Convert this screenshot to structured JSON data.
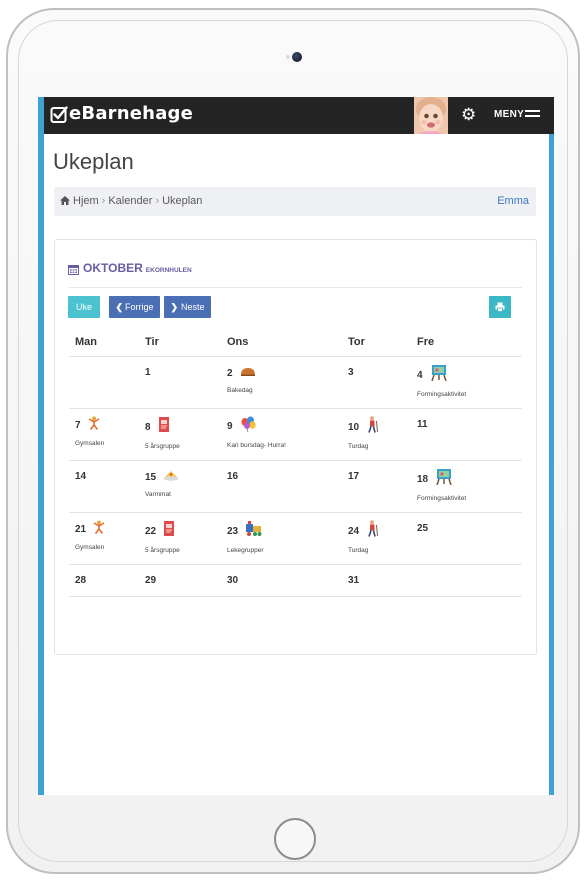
{
  "app": {
    "logo_text": "eBarnehage",
    "menu_label": "MENY"
  },
  "page": {
    "title": "Ukeplan"
  },
  "breadcrumb": {
    "items": [
      "Hjem",
      "Kalender",
      "Ukeplan"
    ],
    "user": "Emma"
  },
  "calendar": {
    "month": "OKTOBER",
    "group": "EKORNHULEN",
    "buttons": {
      "week": "Uke",
      "prev": "Forrige",
      "next": "Neste"
    },
    "days": [
      "Man",
      "Tir",
      "Ons",
      "Tor",
      "Fre"
    ],
    "weeks": [
      [
        {
          "day": "",
          "event": "",
          "icon": ""
        },
        {
          "day": "1",
          "event": "",
          "icon": ""
        },
        {
          "day": "2",
          "event": "Bakedag",
          "icon": "bread-icon"
        },
        {
          "day": "3",
          "event": "",
          "icon": ""
        },
        {
          "day": "4",
          "event": "Formingsaktivitet",
          "icon": "easel-icon"
        }
      ],
      [
        {
          "day": "7",
          "event": "Gymsalen",
          "icon": "gymnast-icon"
        },
        {
          "day": "8",
          "event": "5 årsgruppe",
          "icon": "book-icon"
        },
        {
          "day": "9",
          "event": "Kari bursdag- Hurra!",
          "icon": "balloons-icon"
        },
        {
          "day": "10",
          "event": "Turdag",
          "icon": "hiker-icon"
        },
        {
          "day": "11",
          "event": "",
          "icon": ""
        }
      ],
      [
        {
          "day": "14",
          "event": "",
          "icon": ""
        },
        {
          "day": "15",
          "event": "Varmmat",
          "icon": "food-icon"
        },
        {
          "day": "16",
          "event": "",
          "icon": ""
        },
        {
          "day": "17",
          "event": "",
          "icon": ""
        },
        {
          "day": "18",
          "event": "Formingsaktivitet",
          "icon": "easel-icon"
        }
      ],
      [
        {
          "day": "21",
          "event": "Gymsalen",
          "icon": "gymnast-icon"
        },
        {
          "day": "22",
          "event": "5 årsgruppe",
          "icon": "book-icon"
        },
        {
          "day": "23",
          "event": "Lekegrupper",
          "icon": "toy-train-icon"
        },
        {
          "day": "24",
          "event": "Turdag",
          "icon": "hiker-icon"
        },
        {
          "day": "25",
          "event": "",
          "icon": ""
        }
      ],
      [
        {
          "day": "28",
          "event": "",
          "icon": ""
        },
        {
          "day": "29",
          "event": "",
          "icon": ""
        },
        {
          "day": "30",
          "event": "",
          "icon": ""
        },
        {
          "day": "31",
          "event": "",
          "icon": ""
        },
        {
          "day": "",
          "event": "",
          "icon": ""
        }
      ]
    ]
  },
  "colors": {
    "accent_blue": "#3fa2d4",
    "nav_button": "#4a6fb5",
    "teal_button": "#4ac2cf",
    "month_purple": "#6b5ca5",
    "topbar": "#242424"
  }
}
